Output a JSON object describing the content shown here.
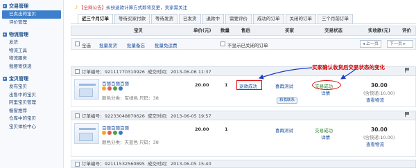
{
  "sidebar": {
    "groups": [
      {
        "title": "交易管理",
        "items": [
          "已卖出的宝贝",
          "评价管理"
        ],
        "selected": 0
      },
      {
        "title": "物流管理",
        "items": [
          "发货",
          "物流工具",
          "物流服务",
          "我要寄快递"
        ]
      },
      {
        "title": "宝贝管理",
        "items": [
          "发布宝贝",
          "出售中的宝贝",
          "阿里宝贝管理",
          "橱窗推荐",
          "仓库中的宝贝",
          "宝贝体检中心"
        ]
      }
    ]
  },
  "notice": {
    "prefix": "【全网公告】",
    "text": "纠纷退款计算方式即将变更，卖家需关注"
  },
  "tabs": [
    "近三个月订单",
    "等待买家付款",
    "等待发货",
    "已发货",
    "退款中",
    "需要评价",
    "成功的订单",
    "关闭的订单",
    "三个月前订单"
  ],
  "table_header": {
    "item": "宝贝",
    "price": "单价(元)",
    "qty": "数量",
    "aftersale": "售后",
    "buyer": "买家",
    "status": "交易状态",
    "paid": "实收款(元)",
    "review": "评价"
  },
  "toolbar": {
    "select_all": "全选",
    "batch_ship": "批量发货",
    "batch_note": "批量备忘",
    "batch_free": "批量免运费",
    "hide_closed": "不显示已关闭的订单",
    "prev": "上一页",
    "next": "下一页"
  },
  "orders": [
    {
      "order_label": "订单编号：",
      "order_no": "92111770310926",
      "time_label": "成交时间：",
      "time": "2013-06-06 11:37",
      "title": "百丽百丽百丽",
      "sku": "颜色分类：军绿色   尺码：38",
      "price": "20.00",
      "qty": "1",
      "aftersale": "退款成功",
      "buyer": "喜再测试",
      "wangwang": "和我联系",
      "status": "交易成功",
      "detail": "详情",
      "paid": "30.00",
      "shipping": "(含快递:10.00)",
      "logistics": "查看物流"
    },
    {
      "order_label": "订单编号：",
      "order_no": "92233048870626",
      "time_label": "成交时间：",
      "time": "2013-06-05 19:57",
      "title": "百丽百丽百丽",
      "sku": "颜色分类：天蓝色   尺码：38",
      "price": "20.00",
      "qty": "1",
      "aftersale": "",
      "buyer": "喜再测试",
      "wangwang": "",
      "status": "交易成功",
      "detail": "详情",
      "paid": "30.00",
      "shipping": "(含快递:10.00)",
      "logistics": "查看物流"
    },
    {
      "order_label": "订单编号：",
      "order_no": "92111532560895",
      "time_label": "成交时间：",
      "time": "2013-06-05 15:40"
    }
  ],
  "annotation": "买家确认收货后交易状态的变化",
  "colors": {
    "accent": "#3e7fcc",
    "annotation": "#d40000",
    "link": "#1a4d9c"
  }
}
